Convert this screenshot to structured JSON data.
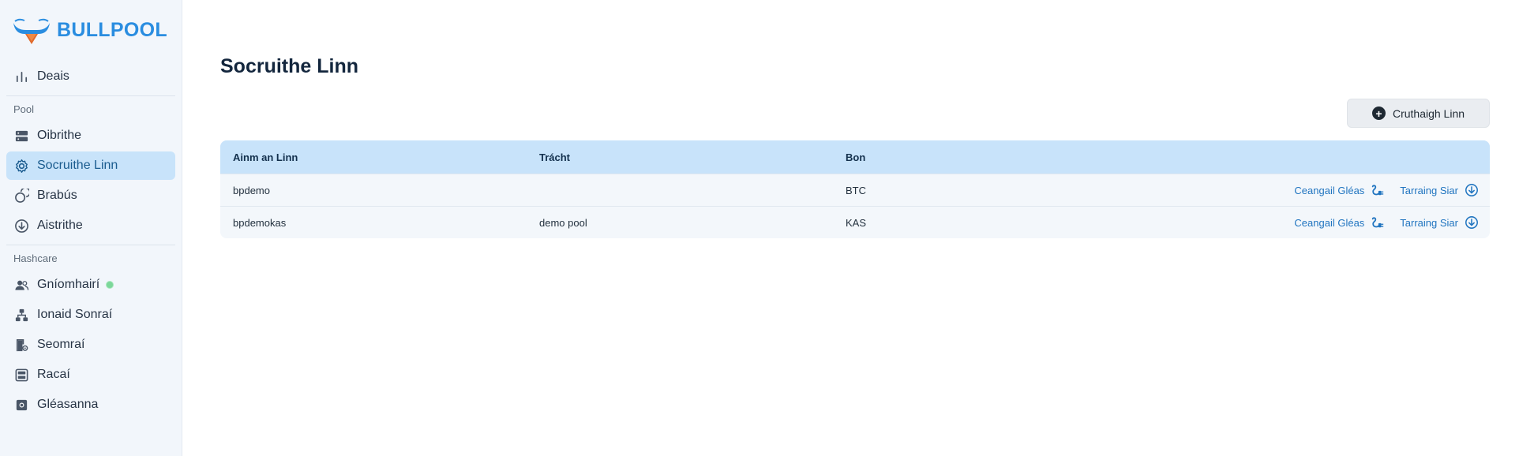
{
  "app": {
    "brand": "BULLPOOL",
    "brand_color": "#2a8de0",
    "accent_color": "#2175c0"
  },
  "sidebar": {
    "top_item": {
      "label": "Deais",
      "icon": "bar-chart-icon"
    },
    "sections": [
      {
        "label": "Pool",
        "items": [
          {
            "label": "Oibrithe",
            "icon": "server-icon"
          },
          {
            "label": "Socruithe Linn",
            "icon": "gear-icon",
            "active": true
          },
          {
            "label": "Brabús",
            "icon": "coins-icon"
          },
          {
            "label": "Aistrithe",
            "icon": "download-circle-icon"
          }
        ]
      },
      {
        "label": "Hashcare",
        "items": [
          {
            "label": "Gníomhairí",
            "icon": "users-icon",
            "status": "online"
          },
          {
            "label": "Ionaid Sonraí",
            "icon": "hierarchy-icon"
          },
          {
            "label": "Seomraí",
            "icon": "room-icon"
          },
          {
            "label": "Racaí",
            "icon": "rack-icon"
          },
          {
            "label": "Gléasanna",
            "icon": "device-icon"
          }
        ]
      }
    ]
  },
  "main": {
    "title": "Socruithe Linn",
    "create_button": "Cruthaigh Linn",
    "table": {
      "columns": [
        "Ainm an Linn",
        "Trácht",
        "Bon"
      ],
      "rows": [
        {
          "name": "bpdemo",
          "traffic": "",
          "coin": "BTC",
          "action_connect": "Ceangail Gléas",
          "action_withdraw": "Tarraing Siar"
        },
        {
          "name": "bpdemokas",
          "traffic": "demo pool",
          "coin": "KAS",
          "action_connect": "Ceangail Gléas",
          "action_withdraw": "Tarraing Siar"
        }
      ]
    }
  }
}
